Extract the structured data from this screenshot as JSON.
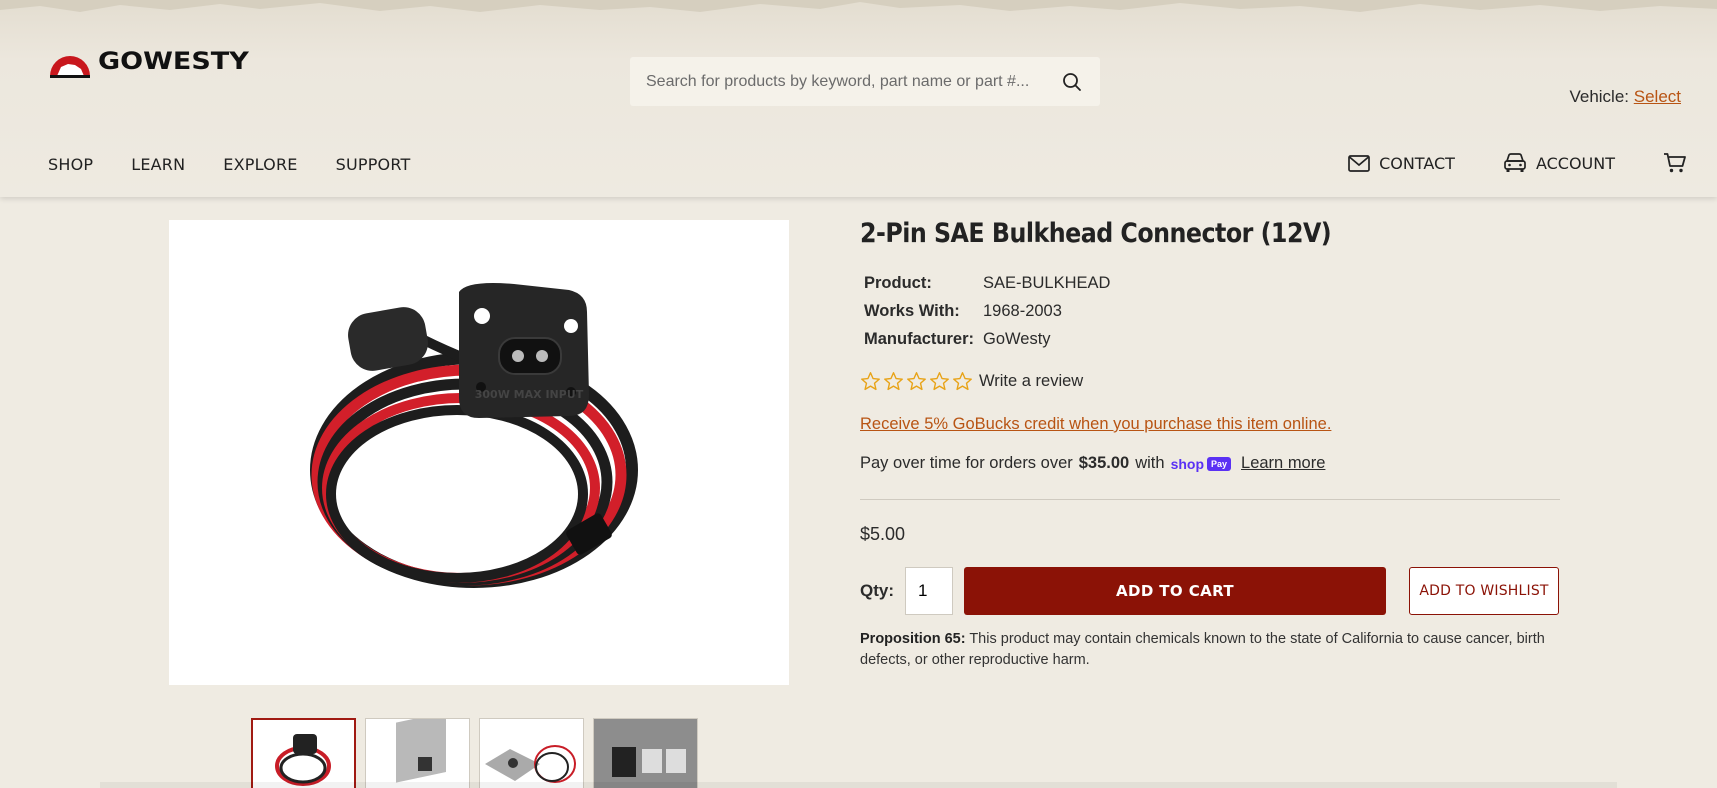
{
  "header": {
    "logo_text": "GOWESTY",
    "search_placeholder": "Search for products by keyword, part name or part #...",
    "vehicle_label": "Vehicle:",
    "vehicle_link": "Select"
  },
  "nav": {
    "items": [
      {
        "label": "SHOP"
      },
      {
        "label": "LEARN"
      },
      {
        "label": "EXPLORE"
      },
      {
        "label": "SUPPORT"
      }
    ],
    "contact_label": "CONTACT",
    "account_label": "ACCOUNT"
  },
  "product": {
    "title": "2-Pin SAE Bulkhead Connector (12V)",
    "specs": [
      {
        "label": "Product:",
        "value": "SAE-BULKHEAD"
      },
      {
        "label": "Works With:",
        "value": "1968-2003"
      },
      {
        "label": "Manufacturer:",
        "value": "GoWesty"
      }
    ],
    "rating": 0,
    "write_review": "Write a review",
    "gobucks_text": "Receive 5% GoBucks credit when you purchase this item online.",
    "payover_prefix": "Pay over time for orders over",
    "payover_amount": "$35.00",
    "payover_with": "with",
    "shoppay_word": "shop",
    "shoppay_badge": "Pay",
    "learn_more": "Learn more",
    "price": "$5.00",
    "qty_label": "Qty:",
    "qty_value": "1",
    "add_to_cart": "ADD TO CART",
    "add_to_wishlist": "ADD TO WISHLIST",
    "prop65_label": "Proposition 65:",
    "prop65_text": "This product may contain chemicals known to the state of California to cause cancer, birth defects, or other reproductive harm.",
    "main_image_text": "300W MAX INPUT"
  },
  "colors": {
    "accent": "#8b1206",
    "link": "#b85413",
    "background": "#efebe2",
    "star": "#e8a317"
  },
  "icons": [
    "search-icon",
    "mail-icon",
    "car-icon",
    "cart-icon",
    "star-icon"
  ]
}
